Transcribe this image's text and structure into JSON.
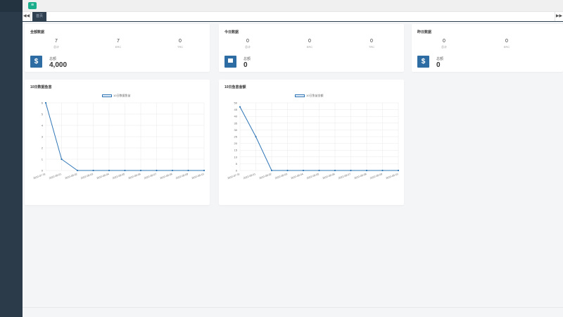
{
  "header": {
    "menu_icon": "menu-icon",
    "menu_color": "#1aad8c"
  },
  "tabs": {
    "prev_icon": "double-chevron-left-icon",
    "next_icon": "double-chevron-right-icon",
    "active_label": "首页"
  },
  "cards": [
    {
      "title": "全部数据",
      "stats": [
        {
          "value": "7",
          "label": "总计"
        },
        {
          "value": "7",
          "label": "ERC"
        },
        {
          "value": "0",
          "label": "TRC"
        }
      ],
      "icon": "dollar-icon",
      "total_label": "总额",
      "total_value": "4,000"
    },
    {
      "title": "今日数据",
      "stats": [
        {
          "value": "0",
          "label": "总计"
        },
        {
          "value": "0",
          "label": "ERC"
        },
        {
          "value": "0",
          "label": "TRC"
        }
      ],
      "icon": "square-icon",
      "total_label": "总额",
      "total_value": "0"
    },
    {
      "title": "昨日数据",
      "stats": [
        {
          "value": "0",
          "label": "总计"
        },
        {
          "value": "0",
          "label": "ERC"
        }
      ],
      "icon": "dollar-icon",
      "total_label": "总额",
      "total_value": "0"
    }
  ],
  "chart_data": [
    {
      "type": "line",
      "title": "10日数据鱼苗",
      "legend": "10日数据鱼苗",
      "x": [
        "2022-07-31",
        "2022-08-01",
        "2022-08-02",
        "2022-08-03",
        "2022-08-04",
        "2022-08-05",
        "2022-08-06",
        "2022-08-07",
        "2022-08-08",
        "2022-08-09",
        "2022-08-10"
      ],
      "series": [
        {
          "name": "10日数据鱼苗",
          "values": [
            6,
            1,
            0,
            0,
            0,
            0,
            0,
            0,
            0,
            0,
            0
          ]
        }
      ],
      "x_tick_labels": [
        "2022-07-31",
        "2022-08-01",
        "2022-08-02",
        "2022-08-03",
        "2022-08-04",
        "2022-08-05",
        "2022-08-06",
        "2022-08-07",
        "2022-08-08",
        "2022-08-09",
        "2022-08-10"
      ],
      "ylim": [
        0,
        6
      ],
      "yticks": [
        0,
        1,
        2,
        3,
        4,
        5,
        6
      ],
      "color": "#2e75b6",
      "grid": true,
      "legend_position": "top-center"
    },
    {
      "type": "line",
      "title": "10日鱼苗金额",
      "legend": "10日鱼苗金额",
      "x": [
        "2022-07-31",
        "2022-08-01",
        "2022-08-02",
        "2022-08-03",
        "2022-08-04",
        "2022-08-05",
        "2022-08-06",
        "2022-08-07",
        "2022-08-08",
        "2022-08-09",
        "2022-08-10"
      ],
      "series": [
        {
          "name": "10日鱼苗金额",
          "values": [
            47,
            25,
            0,
            0,
            0,
            0,
            0,
            0,
            0,
            0,
            0
          ]
        }
      ],
      "x_tick_labels": [
        "2022-07-31",
        "2022-08-01",
        "2022-08-02",
        "2022-08-03",
        "2022-08-04",
        "2022-08-05",
        "2022-08-06",
        "2022-08-07",
        "2022-08-08",
        "2022-08-09",
        "2022-08-10"
      ],
      "ylim": [
        0,
        50
      ],
      "yticks": [
        0,
        5,
        10,
        15,
        20,
        25,
        30,
        35,
        40,
        45,
        50
      ],
      "color": "#2e75b6",
      "grid": true,
      "legend_position": "top-center"
    }
  ]
}
